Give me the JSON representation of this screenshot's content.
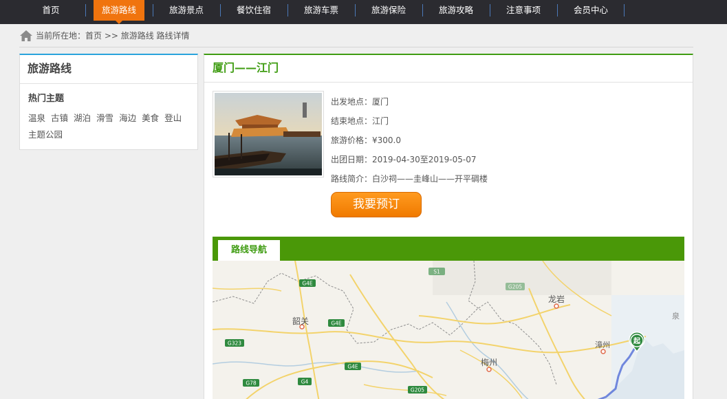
{
  "nav": {
    "items": [
      {
        "label": "首页"
      },
      {
        "label": "旅游路线"
      },
      {
        "label": "旅游景点"
      },
      {
        "label": "餐饮住宿"
      },
      {
        "label": "旅游车票"
      },
      {
        "label": "旅游保险"
      },
      {
        "label": "旅游攻略"
      },
      {
        "label": "注意事项"
      },
      {
        "label": "会员中心"
      }
    ],
    "active_index": 1
  },
  "breadcrumb": {
    "text": "当前所在地：首页 >> 旅游路线 路线详情"
  },
  "sidebar": {
    "title": "旅游路线",
    "subtitle": "热门主题",
    "tags": [
      "温泉",
      "古镇",
      "湖泊",
      "滑雪",
      "海边",
      "美食",
      "登山",
      "主题公园"
    ]
  },
  "detail": {
    "title": "厦门——江门",
    "rows": [
      {
        "label": "出发地点：",
        "value": "厦门"
      },
      {
        "label": "结束地点：",
        "value": "江门"
      },
      {
        "label": "旅游价格：",
        "value": "¥300.0"
      },
      {
        "label": "出团日期：",
        "value": "2019-04-30至2019-05-07"
      },
      {
        "label": "路线简介：",
        "value": "白沙祠——圭峰山——开平碉楼"
      }
    ],
    "book_button": "我要预订"
  },
  "route": {
    "tab_label": "路线导航",
    "map": {
      "cities": [
        "韶关",
        "龙岩",
        "漳州",
        "梅州",
        "泉"
      ],
      "road_shields": [
        "G4E",
        "G4E",
        "G323",
        "G78",
        "G4",
        "G4E",
        "G205",
        "G205",
        "S1"
      ],
      "start_marker": "起"
    }
  },
  "colors": {
    "nav_bg": "#2b2b30",
    "nav_active": "#f0740e",
    "brand_green": "#3f9c12",
    "sidebar_accent": "#29a3dc",
    "button_orange": "#f48a0c"
  }
}
